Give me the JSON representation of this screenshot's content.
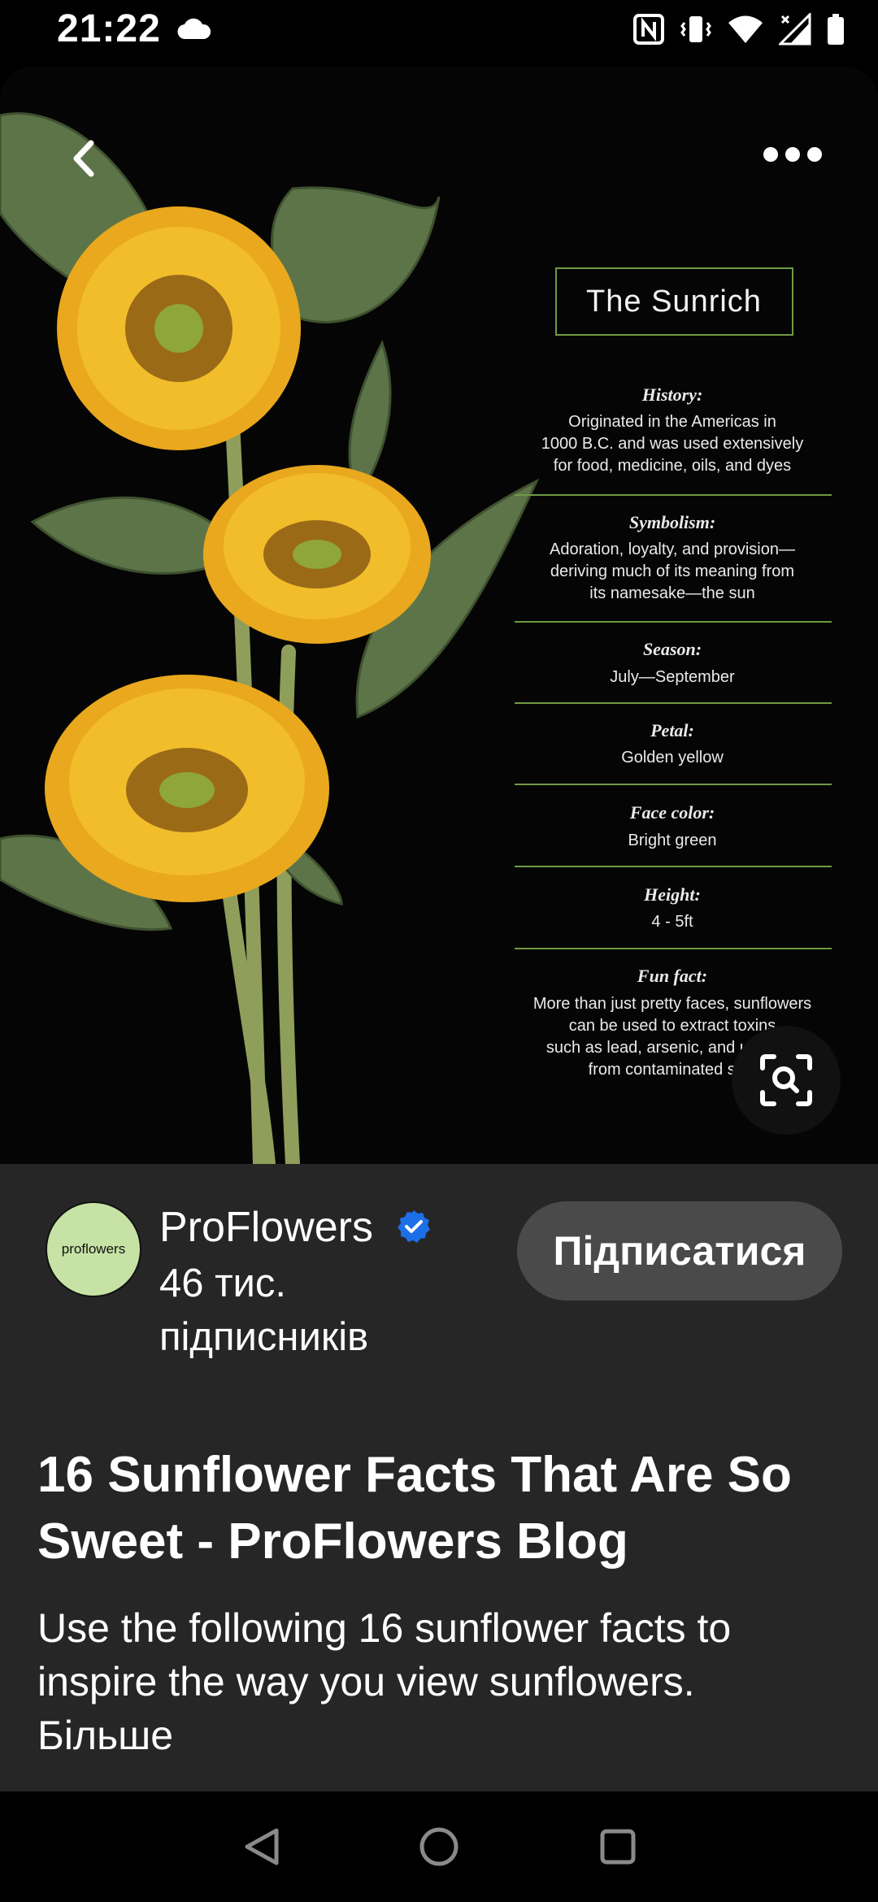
{
  "status_bar": {
    "time": "21:22",
    "icons": [
      "cloud-icon",
      "nfc-icon",
      "vibrate-icon",
      "wifi-icon",
      "signal-icon",
      "battery-icon"
    ]
  },
  "pin_image": {
    "title": "The Sunrich",
    "facts": [
      {
        "label": "History:",
        "lines": [
          "Originated in the Americas in",
          "1000 B.C. and was used extensively",
          "for food, medicine, oils, and dyes"
        ]
      },
      {
        "label": "Symbolism:",
        "lines": [
          "Adoration, loyalty, and provision—",
          "deriving much of its meaning from",
          "its namesake—the sun"
        ]
      },
      {
        "label": "Season:",
        "lines": [
          "July—September"
        ]
      },
      {
        "label": "Petal:",
        "lines": [
          "Golden yellow"
        ]
      },
      {
        "label": "Face color:",
        "lines": [
          "Bright green"
        ]
      },
      {
        "label": "Height:",
        "lines": [
          "4 - 5ft"
        ]
      },
      {
        "label": "Fun fact:",
        "lines": [
          "More than just pretty faces, sunflowers",
          "can be used to extract toxins",
          "such as lead, arsenic, and uranium",
          "from contaminated soil."
        ]
      }
    ]
  },
  "profile": {
    "avatar_text": "proflowers",
    "name": "ProFlowers",
    "followers": "46 тис. підписників",
    "follow_label": "Підписатися"
  },
  "pin": {
    "title": "16 Sunflower Facts That Are So Sweet - ProFlowers Blog",
    "description": "Use the following 16 sunflower facts to inspire the way you view sunflowers.",
    "more_label": "Більше"
  },
  "colors": {
    "panel_bg": "#262626",
    "follow_button_bg": "#4a4a4a",
    "verified_blue": "#1d6fe8",
    "avatar_bg": "#c6e3a5",
    "infographic_line": "#6f9a43"
  }
}
